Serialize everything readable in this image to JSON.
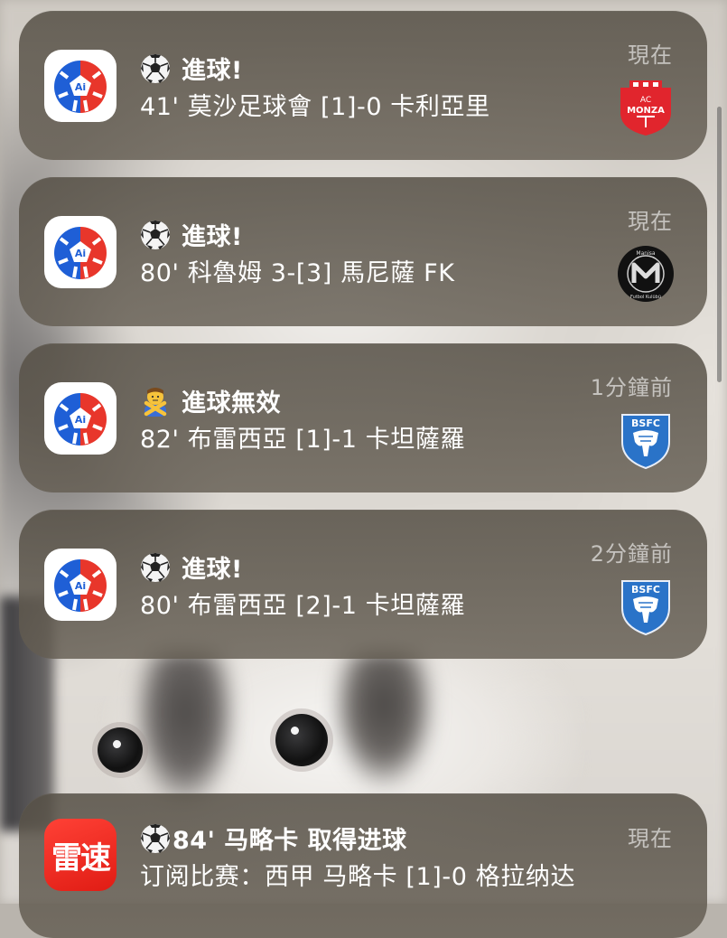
{
  "notifications": [
    {
      "app_icon": "ai-football-icon",
      "title_icon": "soccer-ball-icon",
      "title": "進球!",
      "body": "41' 莫沙足球會 [1]-0 卡利亞里",
      "time": "現在",
      "team_logo": "ac-monza-logo"
    },
    {
      "app_icon": "ai-football-icon",
      "title_icon": "soccer-ball-icon",
      "title": "進球!",
      "body": "80' 科魯姆 3-[3] 馬尼薩 FK",
      "time": "現在",
      "team_logo": "manisa-fk-logo"
    },
    {
      "app_icon": "ai-football-icon",
      "title_icon": "person-crossing-arms-icon",
      "title": "進球無效",
      "body": "82' 布雷西亞 [1]-1 卡坦薩羅",
      "time": "1分鐘前",
      "team_logo": "brescia-logo"
    },
    {
      "app_icon": "ai-football-icon",
      "title_icon": "soccer-ball-icon",
      "title": "進球!",
      "body": "80' 布雷西亞 [2]-1 卡坦薩羅",
      "time": "2分鐘前",
      "team_logo": "brescia-logo"
    },
    {
      "app_icon": "leisu-app-icon",
      "app_icon_text": "雷速",
      "title_icon": "soccer-ball-icon",
      "title": "84' 马略卡 取得进球",
      "body": "订阅比赛：西甲 马略卡 [1]-0 格拉纳达",
      "time": "現在"
    }
  ],
  "logos": {
    "ac_monza_top": "AC",
    "ac_monza_name": "MONZA",
    "manisa_top": "Manisa",
    "manisa_bottom": "Futbol Kulübü",
    "brescia": "BSFC"
  },
  "colors": {
    "card_bg": "#5a5448",
    "ai_icon_blue": "#1f5fd6",
    "ai_icon_red": "#e8362b",
    "monza_red": "#e1252d",
    "brescia_blue": "#2a73c8",
    "leisu_red": "#ef2b22"
  }
}
